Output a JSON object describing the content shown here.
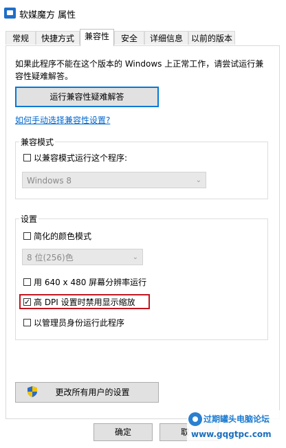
{
  "window": {
    "title": "软媒魔方 属性",
    "icon": "app-icon"
  },
  "tabs": [
    {
      "label": "常规",
      "active": false
    },
    {
      "label": "快捷方式",
      "active": false
    },
    {
      "label": "兼容性",
      "active": true
    },
    {
      "label": "安全",
      "active": false
    },
    {
      "label": "详细信息",
      "active": false
    },
    {
      "label": "以前的版本",
      "active": false
    }
  ],
  "intro_text": "如果此程序不能在这个版本的 Windows 上正常工作，请尝试运行兼容性疑难解答。",
  "troubleshoot_button": "运行兼容性疑难解答",
  "manual_link": "如何手动选择兼容性设置?",
  "compat_mode": {
    "group_title": "兼容模式",
    "checkbox_label": "以兼容模式运行这个程序:",
    "checked": false,
    "select_value": "Windows 8"
  },
  "settings": {
    "group_title": "设置",
    "reduced_color": {
      "label": "简化的颜色模式",
      "checked": false
    },
    "color_select_value": "8 位(256)色",
    "res_640": {
      "label": "用 640 x 480 屏幕分辨率运行",
      "checked": false
    },
    "high_dpi": {
      "label": "高 DPI 设置时禁用显示缩放",
      "checked": true
    },
    "run_admin": {
      "label": "以管理员身份运行此程序",
      "checked": false
    }
  },
  "all_users_button": "更改所有用户的设置",
  "footer": {
    "ok": "确定",
    "cancel_partial": "取"
  },
  "watermark": {
    "title": "过期罐头电脑论坛",
    "url": "www.gqgtpc.com"
  },
  "colors": {
    "link": "#0066cc",
    "highlight": "#c0151d",
    "focus": "#0078d7"
  }
}
